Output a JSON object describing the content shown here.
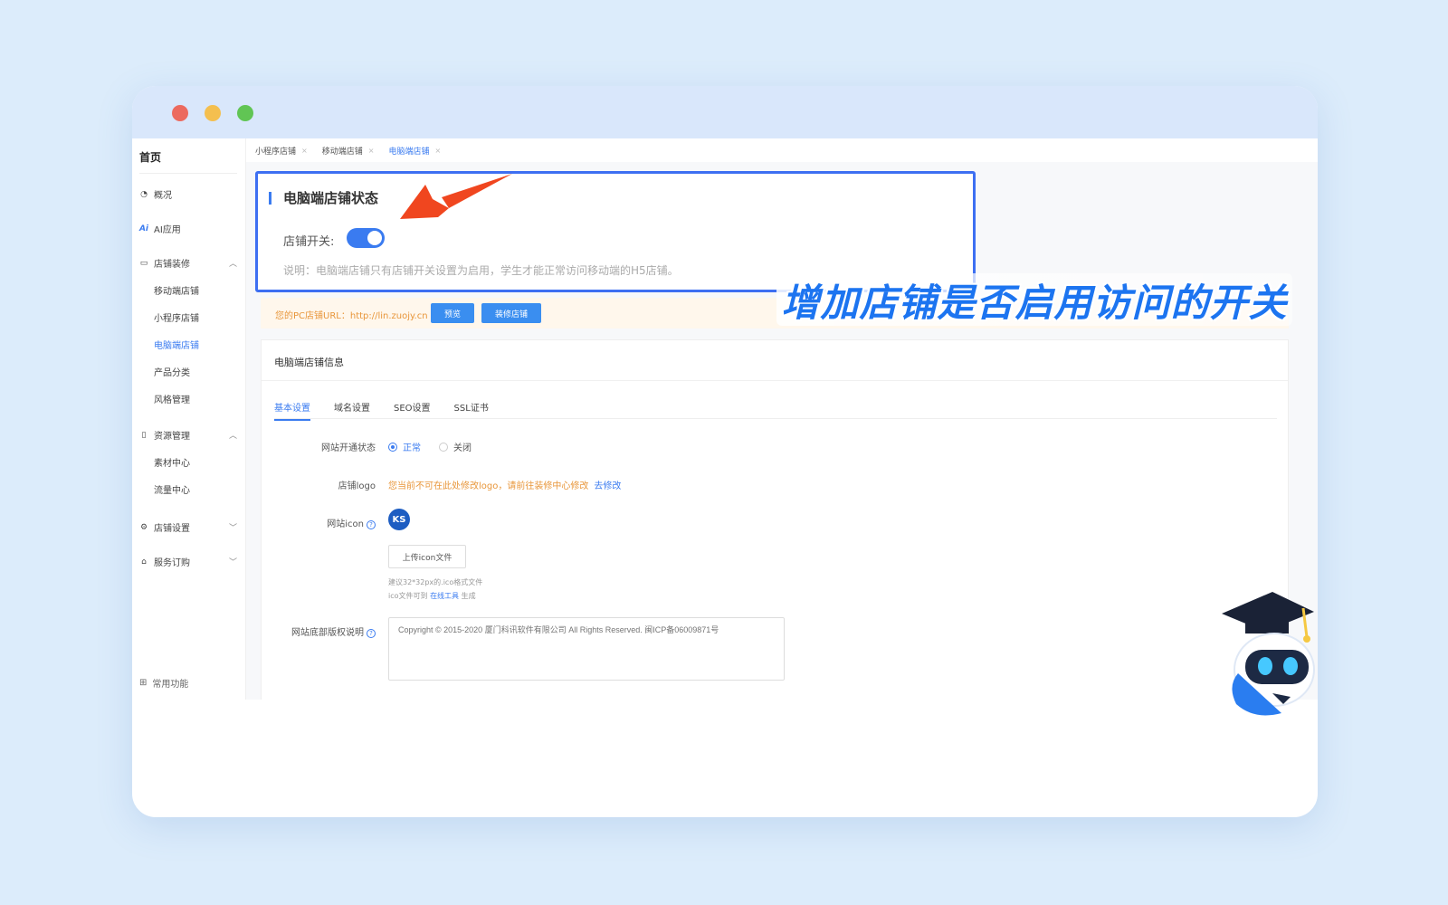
{
  "window": {
    "controls": [
      "close",
      "minimize",
      "maximize"
    ]
  },
  "sidebar": {
    "home": "首页",
    "items": [
      {
        "label": "概况",
        "icon": "dashboard-icon"
      },
      {
        "label": "AI应用",
        "icon": "ai-icon"
      },
      {
        "label": "店铺装修",
        "icon": "store-decor-icon",
        "expanded": true,
        "children": [
          "移动端店铺",
          "小程序店铺",
          "电脑端店铺",
          "产品分类",
          "风格管理"
        ]
      },
      {
        "label": "资源管理",
        "icon": "resource-icon",
        "expanded": true,
        "children": [
          "素材中心",
          "流量中心"
        ]
      },
      {
        "label": "店铺设置",
        "icon": "settings-icon",
        "expanded": false
      },
      {
        "label": "服务订购",
        "icon": "service-icon",
        "expanded": false
      }
    ],
    "active_child": "电脑端店铺",
    "bottom": "常用功能"
  },
  "tabs": [
    "小程序店铺",
    "移动端店铺",
    "电脑端店铺"
  ],
  "status_card": {
    "title": "电脑端店铺状态",
    "switch_label": "店铺开关:",
    "switch_on": true,
    "description": "说明：电脑端店铺只有店铺开关设置为启用，学生才能正常访问移动端的H5店铺。"
  },
  "url_bar": {
    "label": "您的PC店铺URL：http://lin.zuojy.cn",
    "preview_button": "预览",
    "decorate_button": "装修店铺"
  },
  "info_card": {
    "title": "电脑端店铺信息",
    "tabs": [
      "基本设置",
      "域名设置",
      "SEO设置",
      "SSL证书"
    ],
    "active_tab": "基本设置",
    "site_status_label": "网站开通状态",
    "site_status_options": [
      "正常",
      "关闭"
    ],
    "site_status_value": "正常",
    "logo_label": "店铺logo",
    "logo_warning": "您当前不可在此处修改logo，请前往装修中心修改",
    "logo_link": "去修改",
    "icon_label": "网站icon",
    "icon_text": "KS",
    "upload_button": "上传icon文件",
    "hint_line1": "建议32*32px的.ico格式文件",
    "hint_line2_prefix": "ico文件可到",
    "hint_line2_link": "在线工具",
    "hint_line2_suffix": "生成",
    "copyright_label": "网站底部版权说明",
    "copyright_placeholder": "Copyright © 2015-2020 厦门科讯软件有限公司 All Rights Reserved. 闽ICP备06009871号"
  },
  "caption": "增加店铺是否启用访问的开关",
  "colors": {
    "accent": "#3a7bf0",
    "highlight_border": "#3d6ff2",
    "arrow": "#f0461f",
    "caption": "#1c74f0"
  }
}
